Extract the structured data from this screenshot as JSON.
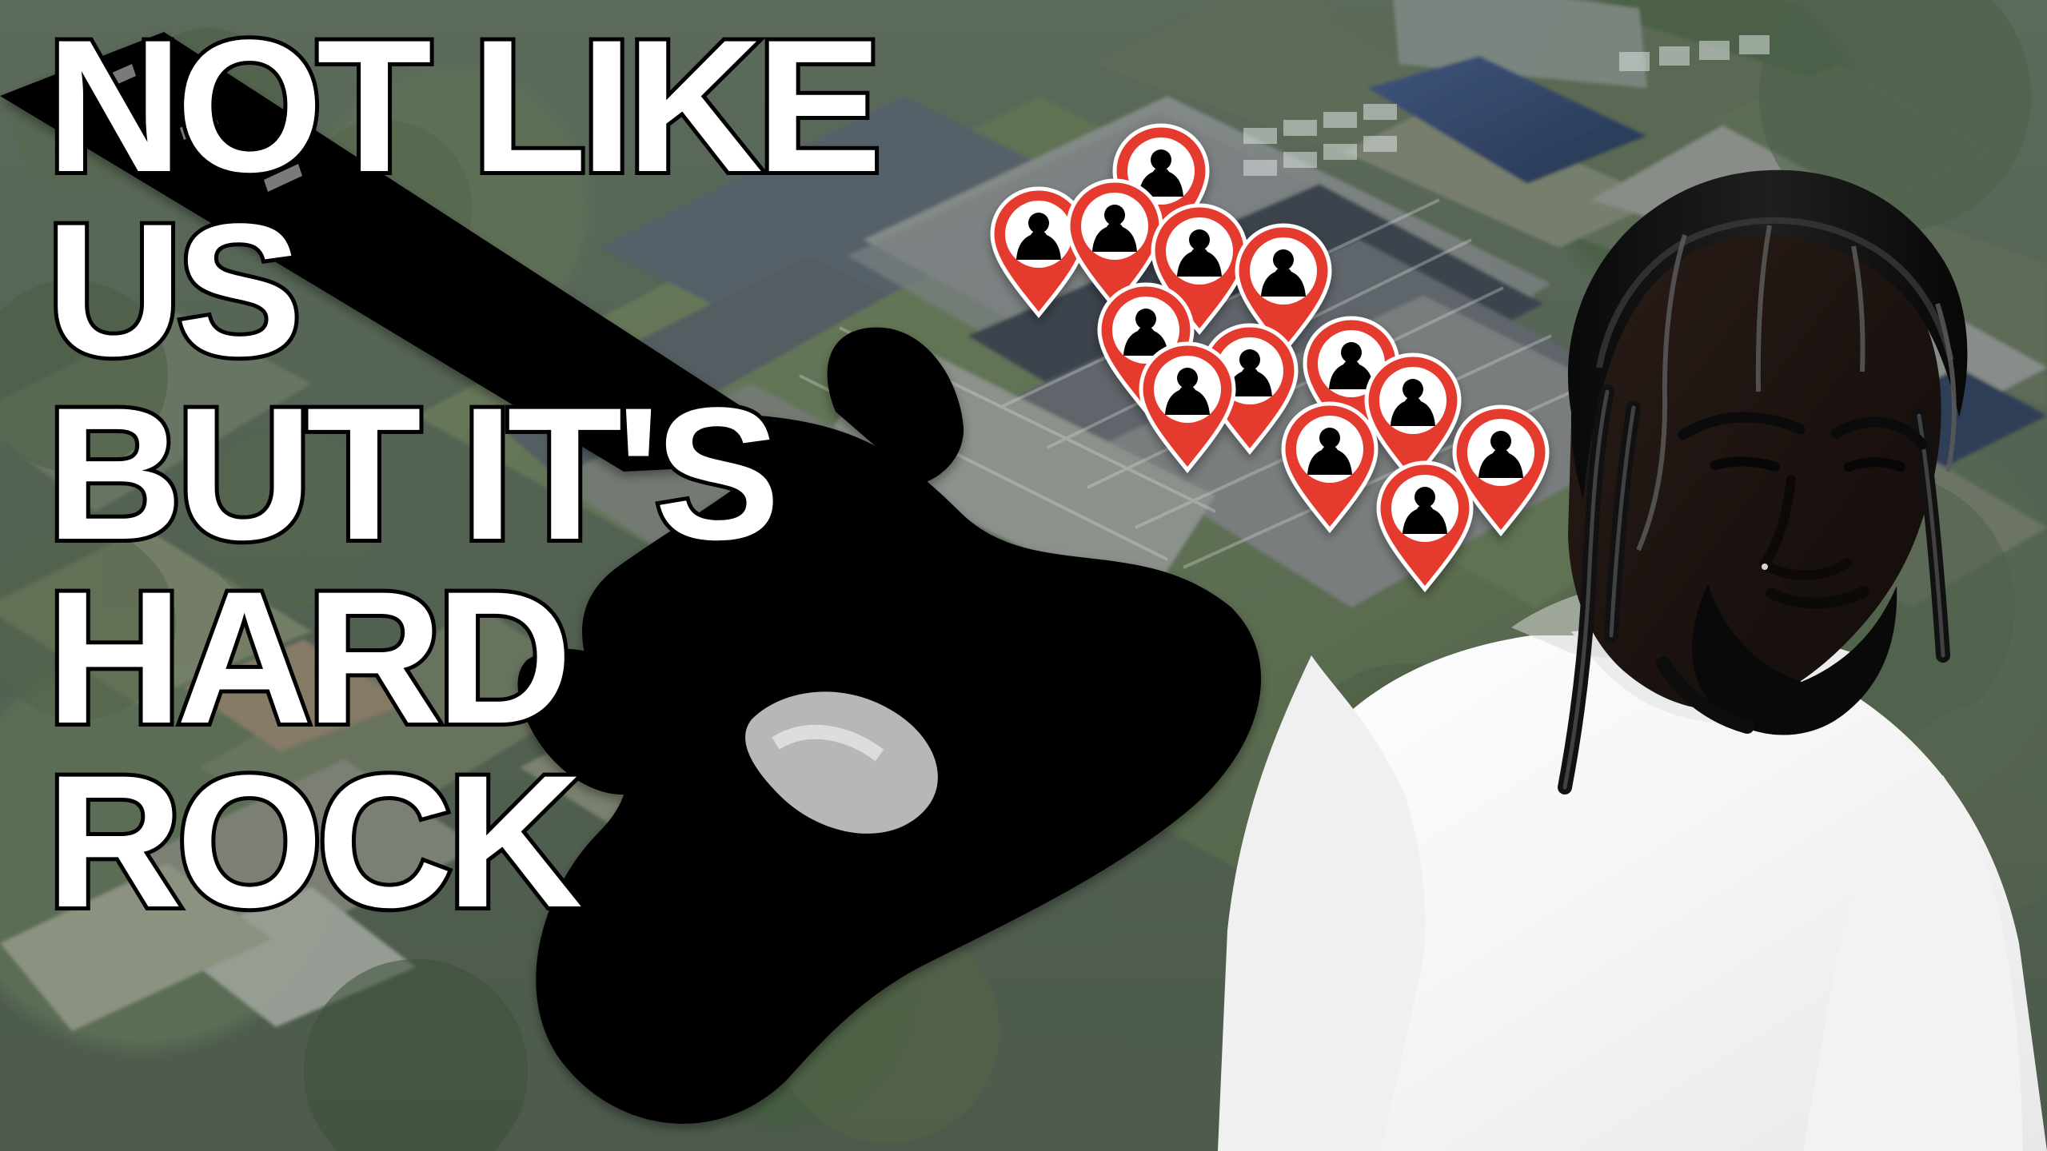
{
  "title": {
    "lines": [
      "NOT LIKE",
      "US",
      "BUT IT'S",
      "HARD",
      "ROCK"
    ]
  },
  "icons": {
    "background": "aerial-map-icon",
    "guitar": "guitar-silhouette-icon",
    "pins": "location-pin-icon",
    "person": "person-portrait-icon"
  },
  "colors": {
    "pin_red": "#e53b2f",
    "title_fill": "#ffffff",
    "title_stroke": "#000000"
  }
}
